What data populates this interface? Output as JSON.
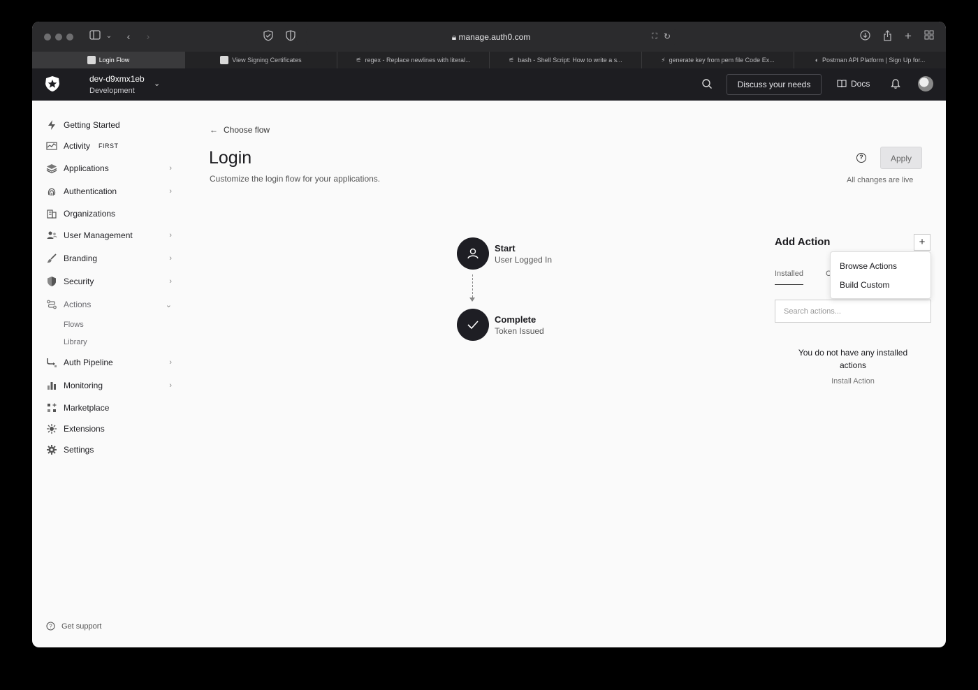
{
  "browser": {
    "url": "manage.auth0.com",
    "tabs": [
      {
        "label": "Login Flow",
        "active": true
      },
      {
        "label": "View Signing Certificates",
        "active": false
      },
      {
        "label": "regex - Replace newlines with literal...",
        "active": false
      },
      {
        "label": "bash - Shell Script: How to write a s...",
        "active": false
      },
      {
        "label": "generate key from pem file Code Ex...",
        "active": false
      },
      {
        "label": "Postman API Platform | Sign Up for...",
        "active": false
      }
    ]
  },
  "header": {
    "tenant_name": "dev-d9xmx1eb",
    "tenant_env": "Development",
    "discuss_label": "Discuss your needs",
    "docs_label": "Docs"
  },
  "sidebar": {
    "items": [
      {
        "label": "Getting Started",
        "icon": "lightning-icon",
        "chevron": false
      },
      {
        "label": "Activity",
        "icon": "activity-icon",
        "badge": "FIRST",
        "chevron": false
      },
      {
        "label": "Applications",
        "icon": "layers-icon",
        "chevron": true
      },
      {
        "label": "Authentication",
        "icon": "fingerprint-icon",
        "chevron": true
      },
      {
        "label": "Organizations",
        "icon": "building-icon",
        "chevron": false
      },
      {
        "label": "User Management",
        "icon": "users-icon",
        "chevron": true
      },
      {
        "label": "Branding",
        "icon": "brush-icon",
        "chevron": true
      },
      {
        "label": "Security",
        "icon": "shield-icon",
        "chevron": true
      },
      {
        "label": "Actions",
        "icon": "actions-icon",
        "chevron": true,
        "expanded": true
      },
      {
        "label": "Auth Pipeline",
        "icon": "pipeline-icon",
        "chevron": true
      },
      {
        "label": "Monitoring",
        "icon": "bar-chart-icon",
        "chevron": true
      },
      {
        "label": "Marketplace",
        "icon": "grid-plus-icon",
        "chevron": false
      },
      {
        "label": "Extensions",
        "icon": "gear-burst-icon",
        "chevron": false
      },
      {
        "label": "Settings",
        "icon": "gear-icon",
        "chevron": false
      }
    ],
    "actions_sub": [
      "Flows",
      "Library"
    ],
    "support_label": "Get support"
  },
  "main": {
    "back_label": "Choose flow",
    "title": "Login",
    "subtitle": "Customize the login flow for your applications.",
    "apply_label": "Apply",
    "live_note": "All changes are live"
  },
  "flow": {
    "start_label": "Start",
    "start_sub": "User Logged In",
    "complete_label": "Complete",
    "complete_sub": "Token Issued"
  },
  "actions_panel": {
    "title": "Add Action",
    "tab_installed": "Installed",
    "tab_custom_partial": "C",
    "menu": [
      "Browse Actions",
      "Build Custom"
    ],
    "search_placeholder": "Search actions...",
    "empty_text": "You do not have any installed actions",
    "install_label": "Install Action"
  }
}
